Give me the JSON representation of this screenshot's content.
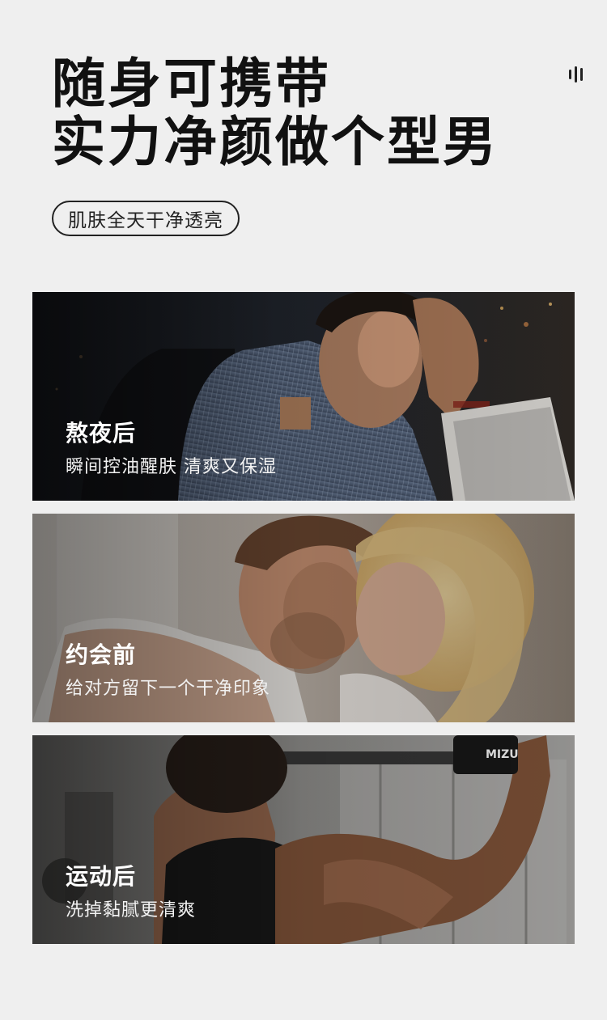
{
  "headline": {
    "line1": "随身可携带",
    "line2": "实力净颜做个型男"
  },
  "badge": "肌肤全天干净透亮",
  "menu_icon": "menu-bars-icon",
  "cards": [
    {
      "title": "熬夜后",
      "desc": "瞬间控油醒肤 清爽又保湿",
      "image": "man-at-laptop-at-night-photo"
    },
    {
      "title": "约会前",
      "desc": "给对方留下一个干净印象",
      "image": "couple-embracing-photo"
    },
    {
      "title": "运动后",
      "desc": "洗掉黏腻更清爽",
      "image": "man-working-out-gym-photo",
      "glove_text": "MIZU"
    }
  ]
}
